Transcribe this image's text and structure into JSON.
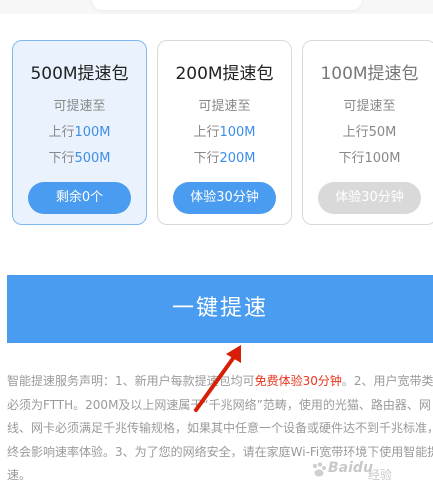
{
  "packages": [
    {
      "title": "500M提速包",
      "line1": "可提速至",
      "up_prefix": "上行",
      "up_value": "100M",
      "down_prefix": "下行",
      "down_value": "500M",
      "button": "剩余0个",
      "selected": true,
      "disabled": false
    },
    {
      "title": "200M提速包",
      "line1": "可提速至",
      "up_prefix": "上行",
      "up_value": "100M",
      "down_prefix": "下行",
      "down_value": "200M",
      "button": "体验30分钟",
      "selected": false,
      "disabled": false
    },
    {
      "title": "100M提速包",
      "line1": "可提速至",
      "up_prefix": "上行",
      "up_value": "50M",
      "down_prefix": "下行",
      "down_value": "100M",
      "button": "体验30分钟",
      "selected": false,
      "disabled": true
    }
  ],
  "main_button": "一键提速",
  "notice": {
    "part1": "智能提速服务声明：1、新用户每款提速包均可",
    "highlight": "免费体验30分钟",
    "part2": "。2、用户宽带类型必须为FTTH。200M及以上网速属于“千兆网络”范畴，使用的光猫、路由器、网线、网卡必须满足千兆传输规格，如果其中任意一个设备或硬件达不到千兆标准，最终会影响速率体验。3、为了您的网络安全，请在家庭Wi-Fi宽带环境下使用智能提速。"
  },
  "watermark": {
    "brand": "Baidu",
    "sub": "经验"
  },
  "colors": {
    "accent": "#4a9cf0",
    "highlight_red": "#e8341c",
    "arrow_red": "#d81e06"
  }
}
